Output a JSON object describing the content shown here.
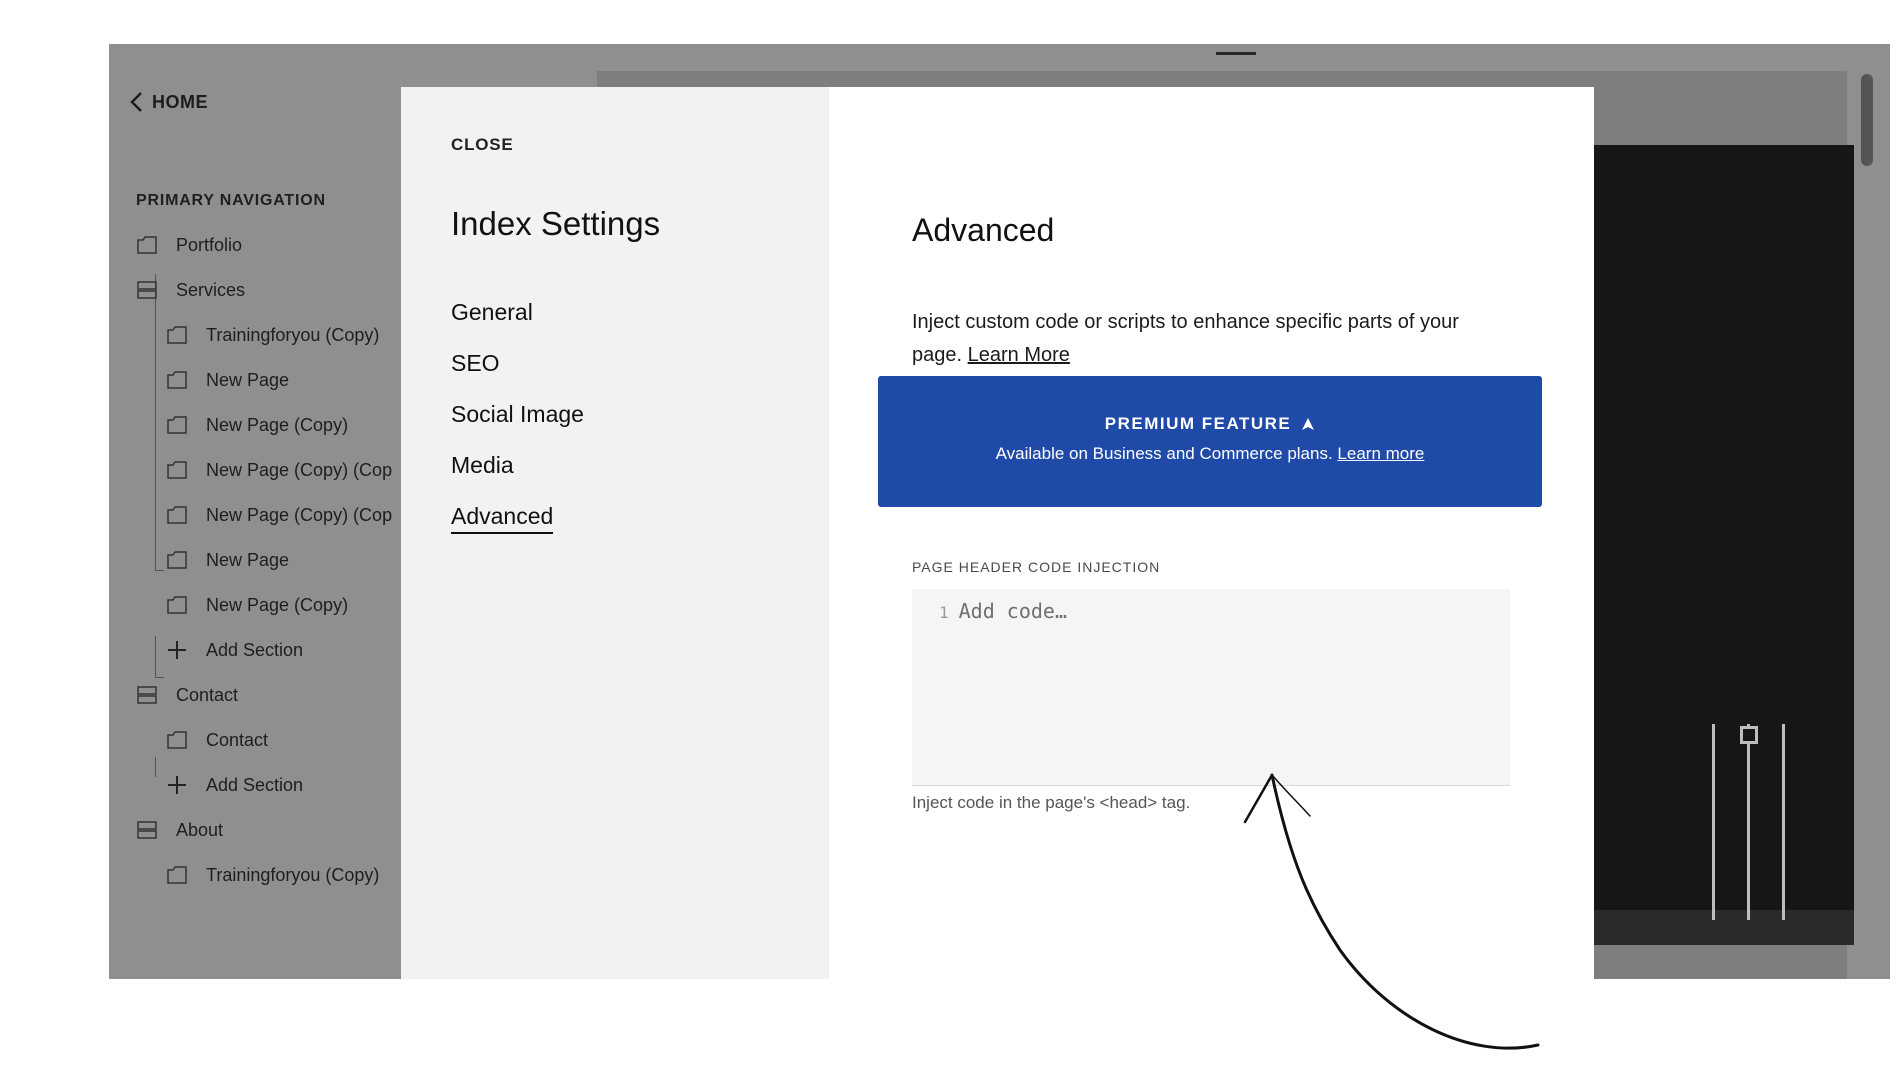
{
  "sidebar": {
    "home_label": "HOME",
    "nav_heading": "PRIMARY NAVIGATION",
    "items": [
      {
        "label": "Portfolio",
        "icon": "page-icon"
      },
      {
        "label": "Services",
        "icon": "section-icon"
      },
      {
        "label": "Trainingforyou (Copy)",
        "icon": "page-icon"
      },
      {
        "label": "New Page",
        "icon": "page-icon"
      },
      {
        "label": "New Page (Copy)",
        "icon": "page-icon"
      },
      {
        "label": "New Page (Copy) (Cop",
        "icon": "page-icon"
      },
      {
        "label": "New Page (Copy) (Cop",
        "icon": "page-icon"
      },
      {
        "label": "New Page",
        "icon": "page-icon"
      },
      {
        "label": "New Page (Copy)",
        "icon": "page-icon"
      },
      {
        "label": "Add Section",
        "icon": "plus-icon"
      },
      {
        "label": "Contact",
        "icon": "section-icon"
      },
      {
        "label": "Contact",
        "icon": "page-icon"
      },
      {
        "label": "Add Section",
        "icon": "plus-icon"
      },
      {
        "label": "About",
        "icon": "section-icon"
      },
      {
        "label": "Trainingforyou (Copy)",
        "icon": "page-icon"
      }
    ]
  },
  "modal": {
    "close_label": "CLOSE",
    "title": "Index Settings",
    "tabs": [
      {
        "label": "General"
      },
      {
        "label": "SEO"
      },
      {
        "label": "Social Image"
      },
      {
        "label": "Media"
      },
      {
        "label": "Advanced",
        "active": true
      }
    ],
    "advanced": {
      "title": "Advanced",
      "description": "Inject custom code or scripts to enhance specific parts of your page.",
      "learn_more": "Learn More",
      "premium": {
        "title": "PREMIUM FEATURE",
        "subtitle": "Available on Business and Commerce plans.",
        "link": "Learn more",
        "color": "#1f4aa8"
      },
      "code_label": "PAGE HEADER CODE INJECTION",
      "code_line_number": "1",
      "code_placeholder": "Add code…",
      "code_help": "Inject code in the page's <head> tag."
    }
  }
}
